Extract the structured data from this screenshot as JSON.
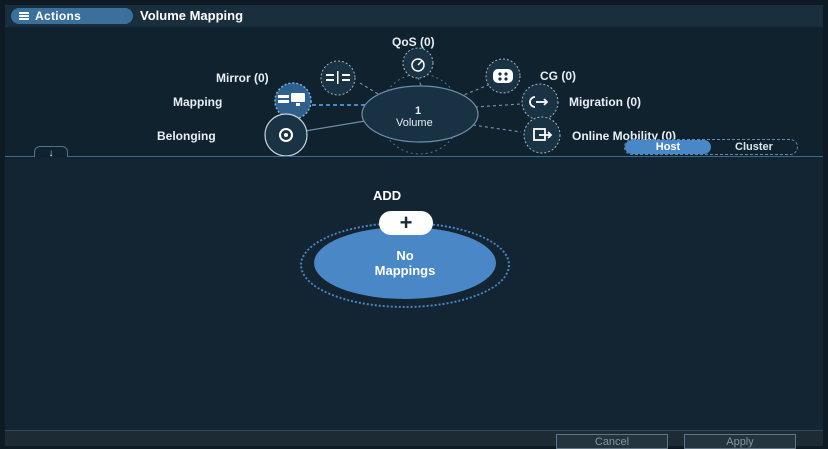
{
  "topbar": {
    "actions_label": "Actions",
    "title": "Volume Mapping"
  },
  "hub": {
    "center": {
      "count": "1",
      "label": "Volume"
    },
    "nodes": {
      "qos": "QoS (0)",
      "mirror": "Mirror (0)",
      "cg": "CG (0)",
      "mapping": "Mapping",
      "migration": "Migration (0)",
      "belonging": "Belonging",
      "online_mobility": "Online Mobility (0)"
    }
  },
  "toggle": {
    "host": "Host",
    "cluster": "Cluster",
    "selected": "Host"
  },
  "main": {
    "add_label": "ADD",
    "add_symbol": "+",
    "empty_line1": "No",
    "empty_line2": "Mappings"
  },
  "footer": {
    "cancel": "Cancel",
    "apply": "Apply"
  },
  "colors": {
    "accent": "#4a87c7",
    "background": "#132532",
    "line": "#6c8ea8"
  }
}
